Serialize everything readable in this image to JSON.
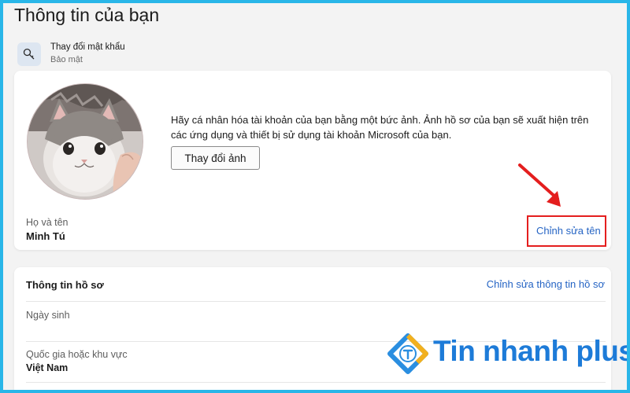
{
  "page": {
    "title": "Thông tin của bạn"
  },
  "password": {
    "title": "Thay đổi mật khẩu",
    "subtitle": "Bảo mật"
  },
  "profile": {
    "description": "Hãy cá nhân hóa tài khoản của bạn bằng một bức ảnh. Ảnh hồ sơ của bạn sẽ xuất hiện trên các ứng dụng và thiết bị sử dụng tài khoản Microsoft của bạn.",
    "change_photo_label": "Thay đổi ảnh",
    "name_label": "Họ và tên",
    "name_value": "Minh Tú",
    "edit_name_label": "Chỉnh sửa tên"
  },
  "info": {
    "title": "Thông tin hồ sơ",
    "edit_label": "Chỉnh sửa thông tin hồ sơ",
    "birthday_label": "Ngày sinh",
    "country_label": "Quốc gia hoặc khu vực",
    "country_value": "Việt Nam"
  },
  "watermark": {
    "text": "Tin nhanh plus"
  },
  "colors": {
    "accent": "#2564c4",
    "highlight": "#e41e1e",
    "frame": "#29b6e8",
    "brand": "#1d7bd8"
  }
}
